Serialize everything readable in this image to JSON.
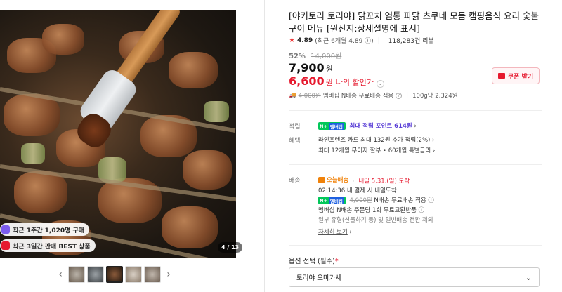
{
  "gallery": {
    "badges": [
      {
        "text": "최근 1주간 1,020명 구매",
        "icon": "purchase-icon",
        "color": "#7b5cf0"
      },
      {
        "text": "최근 3일간 판매 BEST 상품",
        "icon": "best-icon",
        "color": "#e6192e"
      }
    ],
    "counter": "4 / 13",
    "prev_arrow": "‹",
    "next_arrow": "›"
  },
  "product": {
    "title": "[야키토리 토리야] 닭꼬치 염통 파닭 츠쿠네 모듬 캠핑음식 요리 숯불구이 메뉴 [원산지:상세설명에 표시]",
    "rating": "4.89",
    "rating_recent": "(최근 6개월 4.89",
    "reviews": "118,283건 리뷰",
    "discount_rate": "52%",
    "original_price": "14,000원",
    "price": "7,900",
    "price_unit": "원",
    "my_price": "6,600",
    "my_price_unit": "원",
    "my_price_label": "나의 할인가",
    "coupon_button": "쿠폰 받기",
    "shipping_summary": {
      "strike": "4,000원",
      "text": "멤버십 N배송 무료배송 적용",
      "unit_price": "100g당 2,324원"
    }
  },
  "benefits": {
    "points_label": "적립",
    "points_badge": "N+ 멤버십",
    "points_text": "최대 적립 포인트 614원",
    "benefit_label": "혜택",
    "card_text": "라인프렌즈 카드 최대 132원 추가 적립(2%)",
    "installment_text": "최대 12개월 무이자 할부 • 60개월 특별금리"
  },
  "delivery": {
    "label": "배송",
    "today_tag": "오늘배송",
    "arrival": "내일 5.31.(일) 도착",
    "timer": "02:14:36",
    "timer_text": "내 결제 시 내일도착",
    "strike": "4,000원",
    "free_text": "N배송 무료배송 적용",
    "return_text": "멤버십 N배송 주문당 1회 무료교환반품",
    "exclude_text": "일부 유형(선물하기 등) 및 일반배송 전환 제외",
    "detail_link": "자세히 보기"
  },
  "options": {
    "label": "옵션 선택 (필수)",
    "required_mark": "*",
    "selected": "토리야 오마카세"
  },
  "colors": {
    "accent_red": "#e6192e",
    "npay_green": "#03c75a",
    "points_purple": "#5a3fd6",
    "today_orange": "#f0820a"
  }
}
